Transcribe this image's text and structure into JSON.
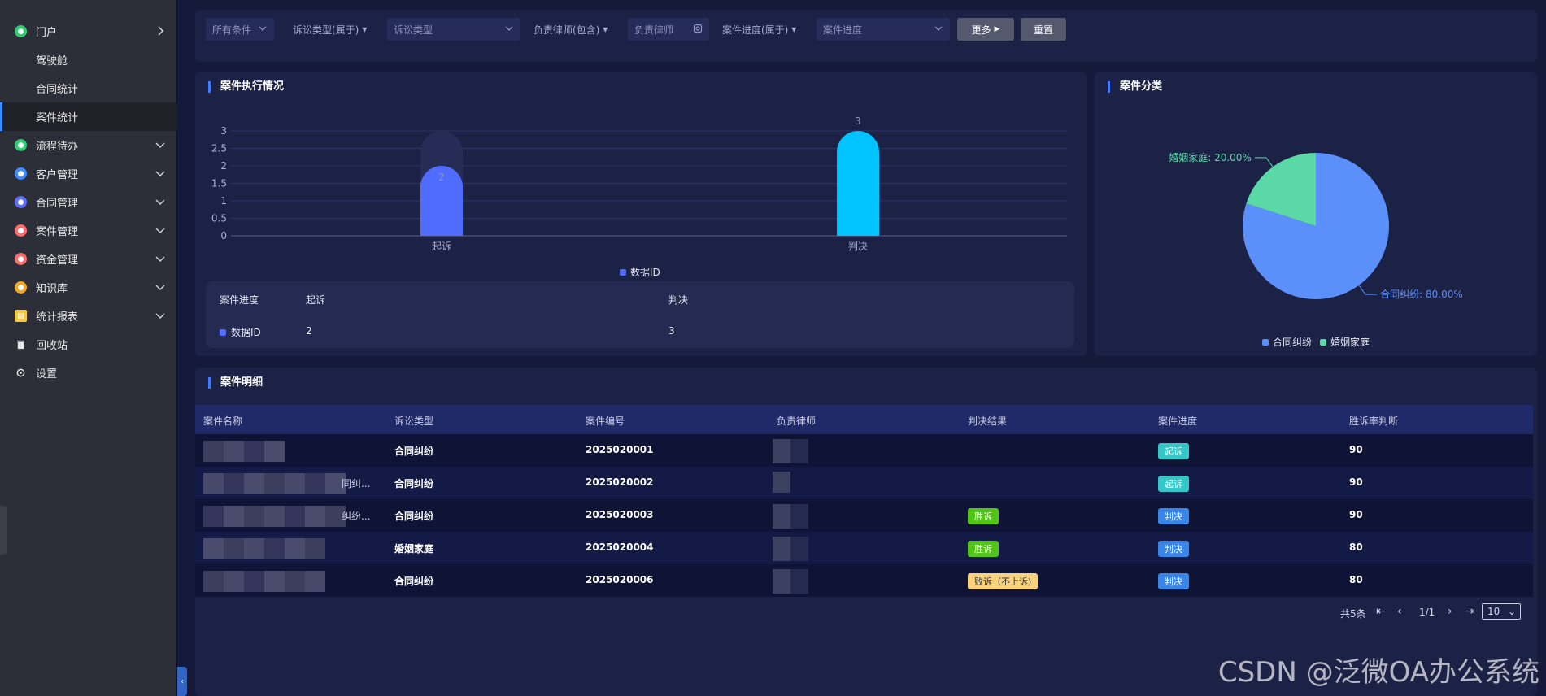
{
  "sidebar": {
    "items": [
      {
        "label": "门户",
        "icon": "home-icon",
        "color": "#2ecc71"
      },
      {
        "label": "驾驶舱"
      },
      {
        "label": "合同统计"
      },
      {
        "label": "案件统计"
      },
      {
        "label": "流程待办",
        "icon": "flow-icon",
        "color": "#2ecc71"
      },
      {
        "label": "客户管理",
        "icon": "customer-icon",
        "color": "#3e8bff"
      },
      {
        "label": "合同管理",
        "icon": "contract-icon",
        "color": "#5b6cff"
      },
      {
        "label": "案件管理",
        "icon": "case-icon",
        "color": "#ff6b6b"
      },
      {
        "label": "资金管理",
        "icon": "money-icon",
        "color": "#ff6b6b"
      },
      {
        "label": "知识库",
        "icon": "knowledge-icon",
        "color": "#f5a623"
      },
      {
        "label": "统计报表",
        "icon": "report-icon",
        "color": "#f5c842"
      },
      {
        "label": "回收站",
        "icon": "trash-icon"
      },
      {
        "label": "设置",
        "icon": "gear-icon"
      }
    ]
  },
  "filters": {
    "all_conditions": "所有条件",
    "litigation_type_label": "诉讼类型(属于)",
    "litigation_type_placeholder": "诉讼类型",
    "lawyer_label": "负责律师(包含)",
    "lawyer_placeholder": "负责律师",
    "progress_label": "案件进度(属于)",
    "progress_placeholder": "案件进度",
    "more_button": "更多",
    "reset_button": "重置"
  },
  "execution_panel": {
    "title": "案件执行情况",
    "legend": "数据ID",
    "table_header": "案件进度",
    "table_row_label": "数据ID"
  },
  "chart_data": [
    {
      "type": "bar",
      "categories": [
        "起诉",
        "判决"
      ],
      "series": [
        {
          "name": "数据ID",
          "values": [
            2,
            3
          ]
        }
      ],
      "ylim": [
        0,
        3
      ],
      "yticks": [
        "0",
        "0.5",
        "1",
        "1.5",
        "2",
        "2.5",
        "3"
      ],
      "data_labels": [
        "2",
        "3"
      ],
      "colors": [
        "#4f6cff",
        "#00c3ff"
      ],
      "grid": true,
      "legend": "bottom"
    },
    {
      "type": "pie",
      "categories": [
        "合同纠纷",
        "婚姻家庭"
      ],
      "values": [
        80,
        20
      ],
      "slice_labels": [
        "合同纠纷: 80.00%",
        "婚姻家庭: 20.00%"
      ],
      "colors": [
        "#5b8ff9",
        "#5ad8a6"
      ],
      "legend": "bottom"
    }
  ],
  "category_panel": {
    "title": "案件分类"
  },
  "detail_panel": {
    "title": "案件明细",
    "columns": [
      "案件名称",
      "诉讼类型",
      "案件编号",
      "负责律师",
      "判决结果",
      "案件进度",
      "胜诉率判断"
    ],
    "rows": [
      {
        "name_suffix": "",
        "type": "合同纠纷",
        "number": "2025020001",
        "result": "",
        "progress": "起诉",
        "rate": "90"
      },
      {
        "name_suffix": "同纠...",
        "type": "合同纠纷",
        "number": "2025020002",
        "result": "",
        "progress": "起诉",
        "rate": "90"
      },
      {
        "name_suffix": "纠纷...",
        "type": "合同纠纷",
        "number": "2025020003",
        "result": "胜诉",
        "progress": "判决",
        "rate": "90"
      },
      {
        "name_suffix": "",
        "type": "婚姻家庭",
        "number": "2025020004",
        "result": "胜诉",
        "progress": "判决",
        "rate": "80"
      },
      {
        "name_suffix": "",
        "type": "合同纠纷",
        "number": "2025020006",
        "result": "败诉（不上诉)",
        "progress": "判决",
        "rate": "80"
      }
    ]
  },
  "pager": {
    "total": "共5条",
    "page": "1/1",
    "page_size": "10"
  },
  "watermark": "CSDN @泛微OA办公系统"
}
